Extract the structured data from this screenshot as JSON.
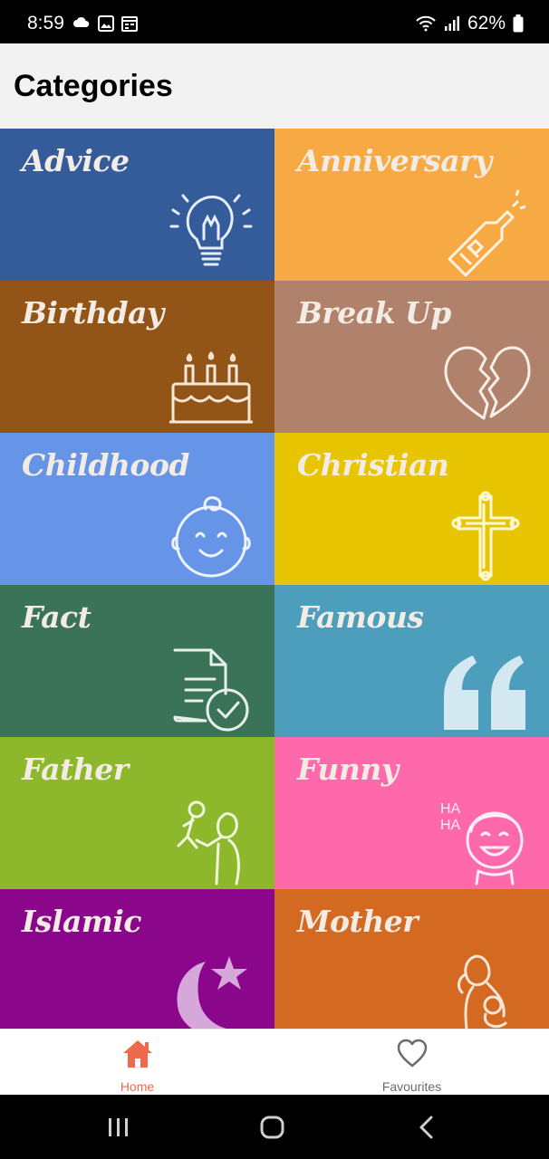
{
  "status_bar": {
    "time": "8:59",
    "battery": "62%",
    "left_icons": [
      "cloud-icon",
      "gallery-icon",
      "calendar-icon"
    ],
    "right_icons": [
      "wifi-icon",
      "signal-icon",
      "battery-icon"
    ]
  },
  "header": {
    "title": "Categories"
  },
  "categories": [
    {
      "label": "Advice",
      "color": "#345b9a",
      "icon": "lightbulb-icon"
    },
    {
      "label": "Anniversary",
      "color": "#f7a944",
      "icon": "champagne-bottle-icon"
    },
    {
      "label": "Birthday",
      "color": "#935418",
      "icon": "birthday-cake-icon"
    },
    {
      "label": "Break Up",
      "color": "#b0826b",
      "icon": "broken-heart-icon"
    },
    {
      "label": "Childhood",
      "color": "#6695e8",
      "icon": "baby-face-icon"
    },
    {
      "label": "Christian",
      "color": "#e8c502",
      "icon": "cross-icon"
    },
    {
      "label": "Fact",
      "color": "#3b7359",
      "icon": "document-check-icon"
    },
    {
      "label": "Famous",
      "color": "#4d9dbd",
      "icon": "quote-icon"
    },
    {
      "label": "Father",
      "color": "#8db82b",
      "icon": "father-child-icon"
    },
    {
      "label": "Funny",
      "color": "#fd69aa",
      "icon": "laughing-face-icon"
    },
    {
      "label": "Islamic",
      "color": "#8a068a",
      "icon": "crescent-star-icon"
    },
    {
      "label": "Mother",
      "color": "#d46a21",
      "icon": "mother-baby-icon"
    }
  ],
  "bottom_nav": {
    "home_label": "Home",
    "favourites_label": "Favourites",
    "active": "Home",
    "active_color": "#ef6a4a"
  },
  "system_nav": [
    "recent-apps-icon",
    "home-circle-icon",
    "back-icon"
  ]
}
